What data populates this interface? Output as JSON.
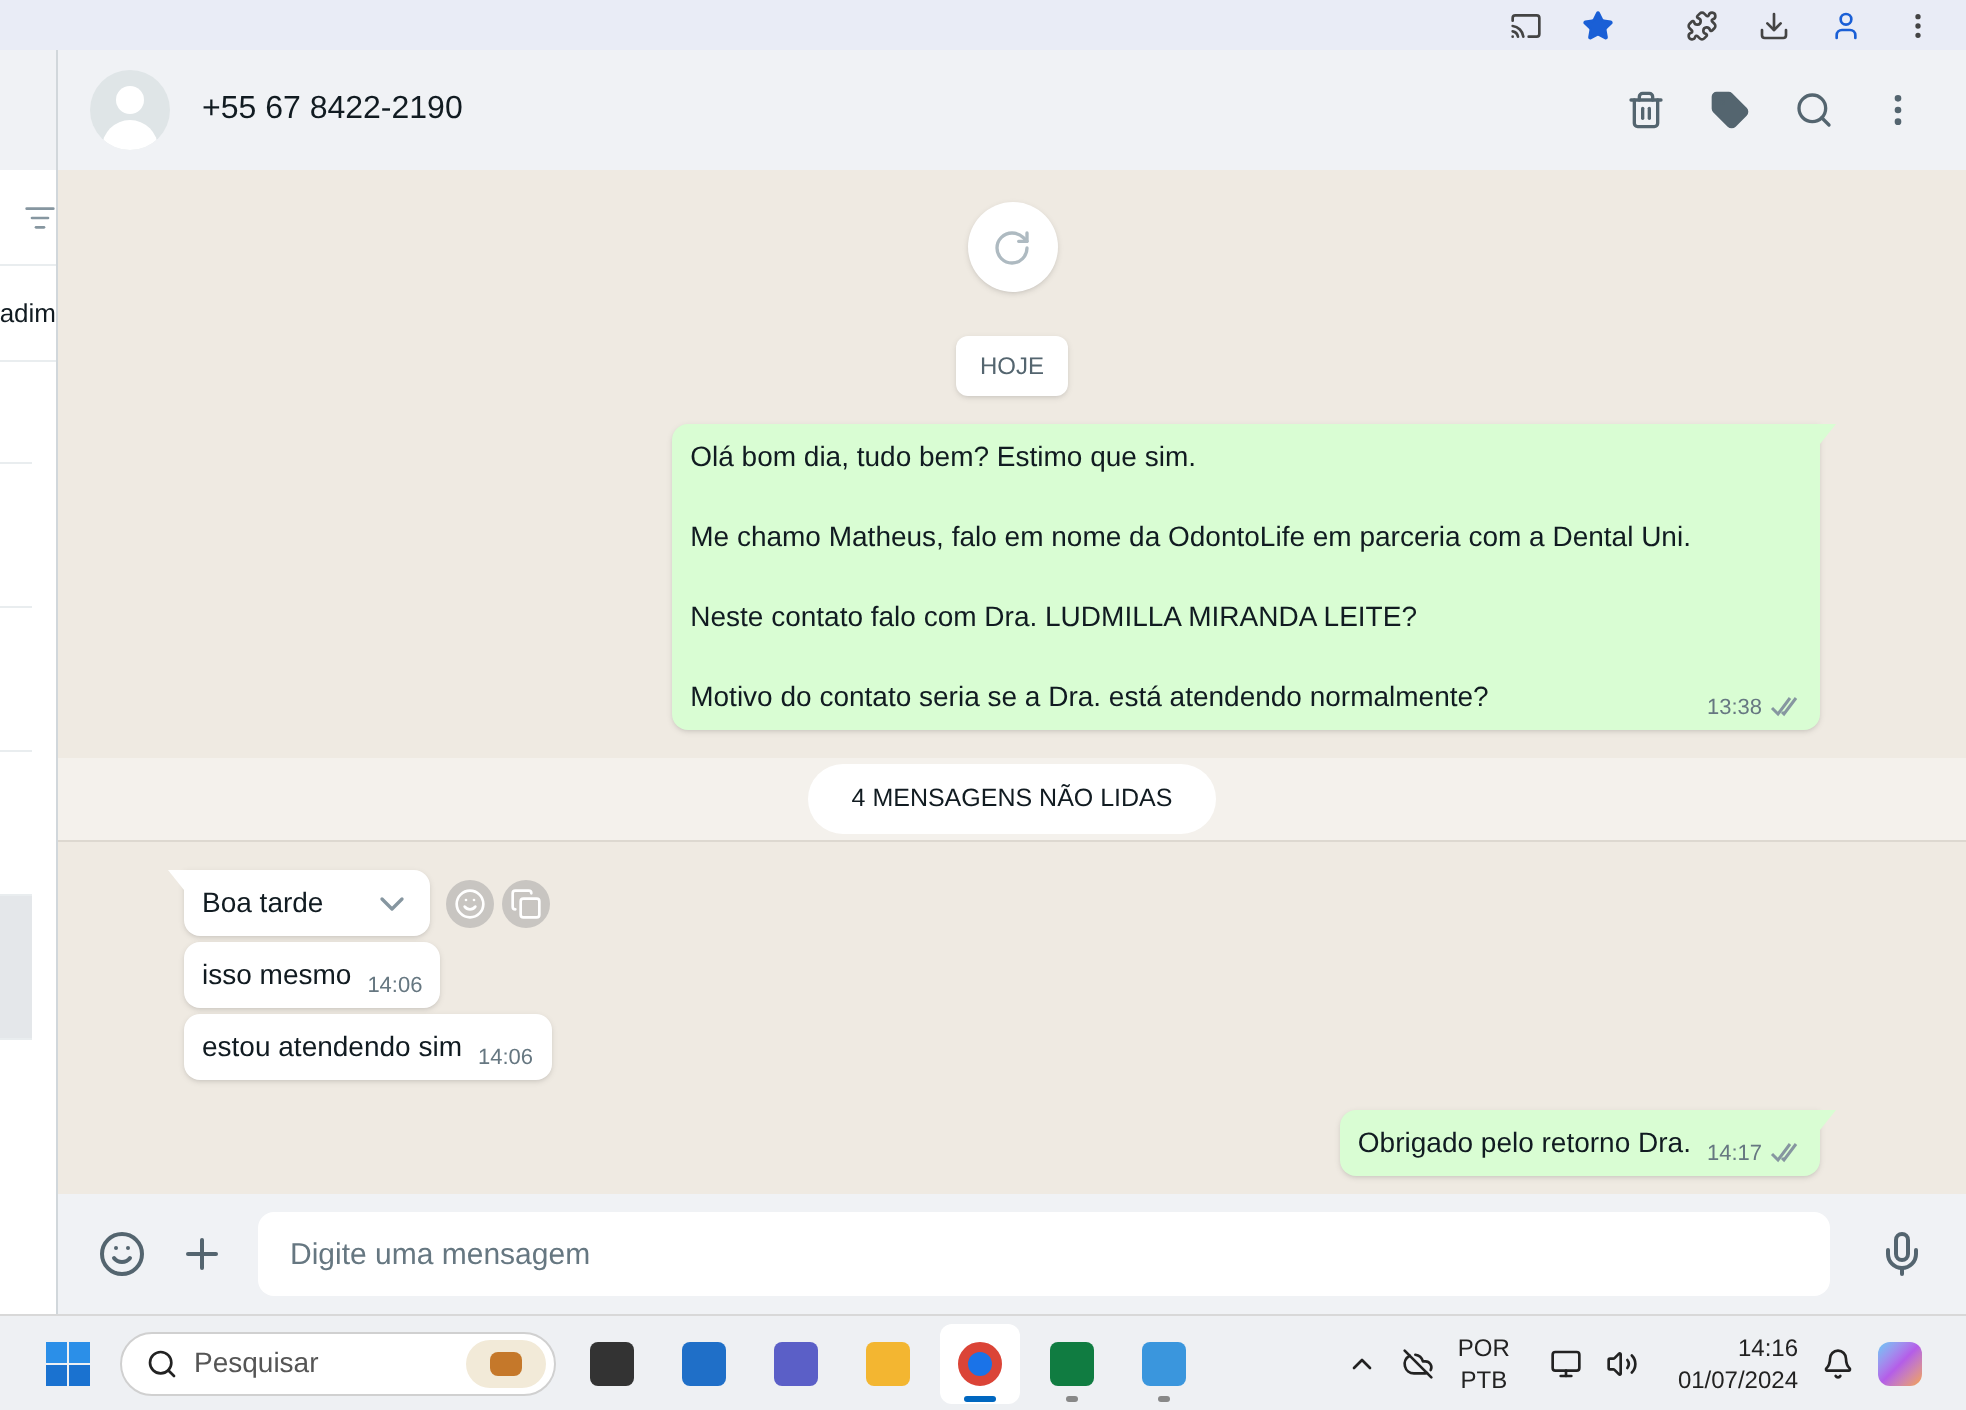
{
  "sidebar": {
    "partial_label": "adim",
    "items": [
      {
        "selected": false
      },
      {
        "selected": false
      },
      {
        "selected": false
      },
      {
        "selected": true
      },
      {
        "selected": false
      }
    ]
  },
  "chat_header": {
    "contact": "+55 67 8422-2190"
  },
  "date_chip": "HOJE",
  "messages_before": [
    {
      "kind": "outgoing",
      "paragraphs": [
        "Olá bom dia, tudo bem? Estimo que sim.",
        "Me chamo Matheus, falo em nome da OdontoLife em parceria com a Dental Uni.",
        "Neste contato falo com Dra. LUDMILLA MIRANDA LEITE?",
        "Motivo do contato seria se a Dra. está atendendo normalmente?"
      ],
      "time": "13:38",
      "read": false
    }
  ],
  "unread_banner": "4 MENSAGENS NÃO LIDAS",
  "messages_after": [
    {
      "kind": "incoming",
      "paragraphs": [
        "Boa tarde"
      ],
      "hovered": true
    },
    {
      "kind": "incoming",
      "paragraphs": [
        "isso mesmo"
      ],
      "time": "14:06",
      "hovered": false
    },
    {
      "kind": "incoming",
      "paragraphs": [
        "estou atendendo sim"
      ],
      "time": "14:06",
      "hovered": false
    },
    {
      "kind": "outgoing",
      "paragraphs": [
        "Obrigado pelo retorno Dra."
      ],
      "time": "14:17",
      "read": false
    }
  ],
  "composer": {
    "placeholder": "Digite uma mensagem"
  },
  "taskbar": {
    "search_placeholder": "Pesquisar",
    "apps": [
      {
        "kind": "taskview",
        "running": false,
        "selected": false
      },
      {
        "kind": "store",
        "running": false,
        "selected": false
      },
      {
        "kind": "teams",
        "running": false,
        "selected": false
      },
      {
        "kind": "folder",
        "running": false,
        "selected": false
      },
      {
        "kind": "chrome",
        "running": true,
        "selected": true
      },
      {
        "kind": "excel",
        "running": true,
        "selected": false
      },
      {
        "kind": "notepad",
        "running": true,
        "selected": false
      }
    ],
    "language": [
      "POR",
      "PTB"
    ],
    "time": "14:16",
    "date": "01/07/2024"
  }
}
